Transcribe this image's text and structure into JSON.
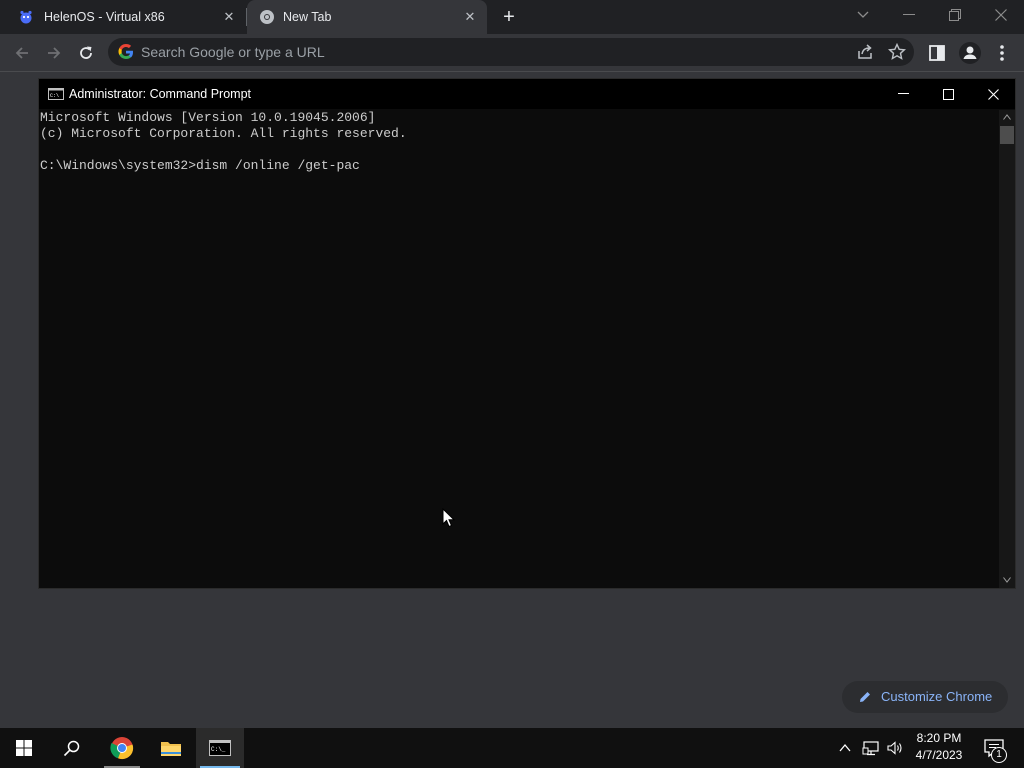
{
  "browser": {
    "tabs": [
      {
        "title": "HelenOS - Virtual x86",
        "favicon": "helenos-favicon-icon",
        "active": false
      },
      {
        "title": "New Tab",
        "favicon": "chrome-favicon-icon",
        "active": true
      }
    ],
    "omnibox": {
      "placeholder": "Search Google or type a URL",
      "value": ""
    },
    "customize_label": "Customize Chrome"
  },
  "cmd": {
    "title": "Administrator: Command Prompt",
    "lines": [
      "Microsoft Windows [Version 10.0.19045.2006]",
      "(c) Microsoft Corporation. All rights reserved.",
      "",
      "C:\\Windows\\system32>dism /online /get-pac"
    ]
  },
  "taskbar": {
    "clock_time": "8:20 PM",
    "clock_date": "4/7/2023",
    "notification_count": "1",
    "active_app": "command-prompt"
  },
  "colors": {
    "chrome_frame": "#202124",
    "chrome_toolbar": "#35363a",
    "cmd_bg": "#0c0c0c",
    "cmd_text": "#cccccc",
    "accent_link": "#8ab4f8",
    "taskbar": "#101010"
  }
}
